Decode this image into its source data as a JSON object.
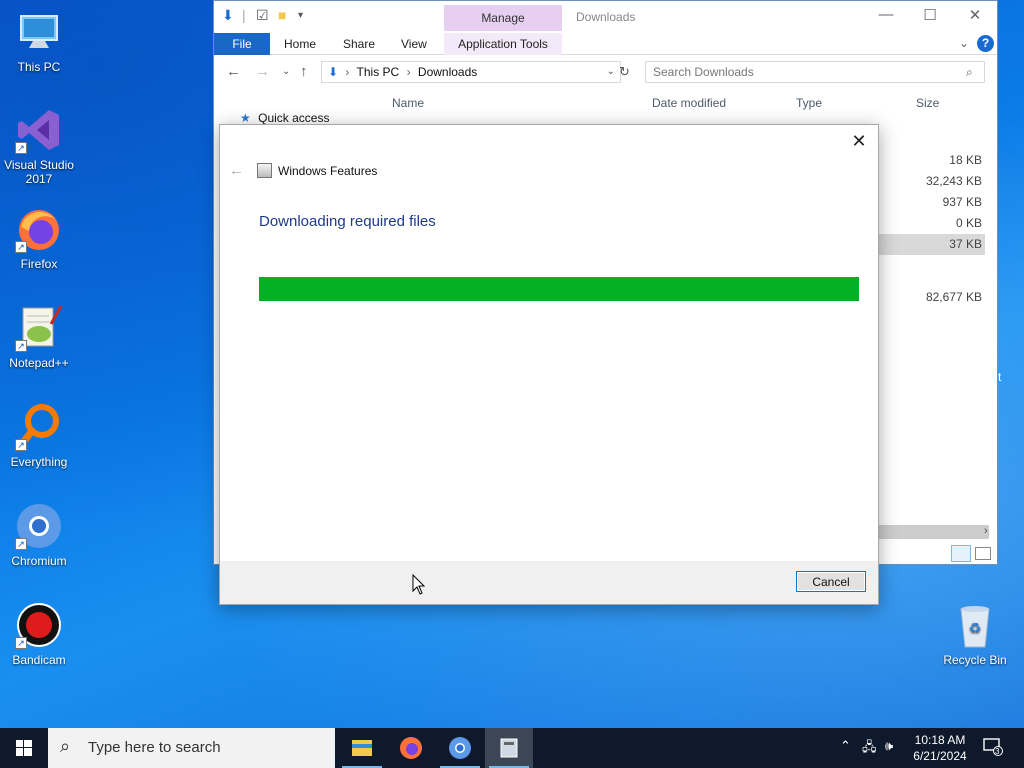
{
  "desktop": {
    "icons": [
      {
        "label": "This PC",
        "icon": "this-pc-icon"
      },
      {
        "label": "Visual Studio 2017",
        "icon": "visual-studio-icon"
      },
      {
        "label": "Firefox",
        "icon": "firefox-icon"
      },
      {
        "label": "Notepad++",
        "icon": "notepadpp-icon"
      },
      {
        "label": "Everything",
        "icon": "everything-icon"
      },
      {
        "label": "Chromium",
        "icon": "chromium-icon"
      },
      {
        "label": "Bandicam",
        "icon": "bandicam-icon"
      },
      {
        "label": "Recycle Bin",
        "icon": "recycle-bin-icon"
      }
    ]
  },
  "explorer": {
    "title": "Downloads",
    "manage_tab": "Manage",
    "ribbon_tabs": [
      "File",
      "Home",
      "Share",
      "View",
      "Application Tools"
    ],
    "address": {
      "root": "This PC",
      "folder": "Downloads"
    },
    "search_placeholder": "Search Downloads",
    "nav": {
      "quick_access": "Quick access"
    },
    "columns": {
      "name": "Name",
      "date_modified": "Date modified",
      "type": "Type",
      "size": "Size"
    },
    "sizes": [
      "18 KB",
      "32,243 KB",
      "937 KB",
      "0 KB",
      "37 KB",
      "82,677 KB"
    ],
    "partial_text": "t"
  },
  "dialog": {
    "app_title": "Windows Features",
    "heading": "Downloading required files",
    "progress_fraction": 1.0,
    "cancel_label": "Cancel"
  },
  "taskbar": {
    "search_placeholder": "Type here to search",
    "time": "10:18 AM",
    "date": "6/21/2024",
    "notification_count": "3"
  },
  "colors": {
    "progress_fill": "#06b025",
    "accent": "#1968c5",
    "heading": "#1e3a8a"
  }
}
